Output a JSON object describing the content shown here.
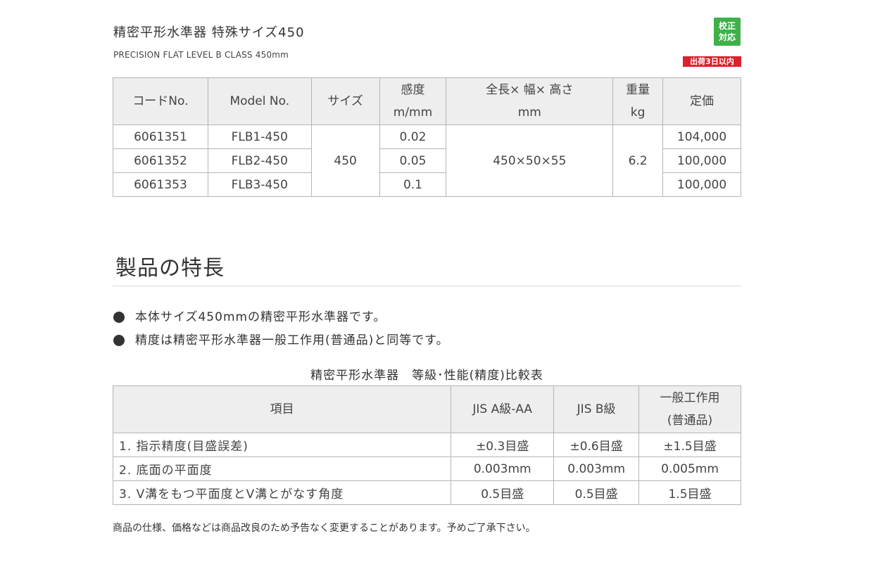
{
  "header": {
    "title": "精密平形水準器 特殊サイズ450",
    "subtitle": "PRECISION FLAT LEVEL B CLASS 450mm",
    "badge_calibration": "校正対応",
    "badge_shipping": "出荷3日以内",
    "colors": {
      "calibration_badge": "#3fb04a",
      "shipping_badge": "#d9232f"
    }
  },
  "spec_table": {
    "headers": {
      "code": "コードNo.",
      "model": "Model No.",
      "size": "サイズ",
      "sensitivity_line1": "感度",
      "sensitivity_line2": "m/mm",
      "dims_line1": "全長× 幅× 高さ",
      "dims_line2": "mm",
      "weight_line1": "重量",
      "weight_line2": "kg",
      "price": "定価"
    },
    "rows": [
      {
        "code": "6061351",
        "model": "FLB1-450",
        "sensitivity": "0.02",
        "price": "104,000"
      },
      {
        "code": "6061352",
        "model": "FLB2-450",
        "sensitivity": "0.05",
        "price": "100,000"
      },
      {
        "code": "6061353",
        "model": "FLB3-450",
        "sensitivity": "0.1",
        "price": "100,000"
      }
    ],
    "shared": {
      "size": "450",
      "dims": "450×50×55",
      "weight": "6.2"
    }
  },
  "features": {
    "heading": "製品の特長",
    "bullets": [
      "本体サイズ450mmの精密平形水準器です。",
      "精度は精密平形水準器一般工作用(普通品)と同等です。"
    ]
  },
  "comparison": {
    "caption": "精密平形水準器　等級･性能(精度)比較表",
    "headers": {
      "item": "項目",
      "jis_aa": "JIS A級-AA",
      "jis_b": "JIS B級",
      "general_line1": "一般工作用",
      "general_line2": "(普通品)"
    },
    "rows": [
      {
        "item": "1. 指示精度(目盛誤差)",
        "jis_aa": "±0.3目盛",
        "jis_b": "±0.6目盛",
        "general": "±1.5目盛"
      },
      {
        "item": "2. 底面の平面度",
        "jis_aa": "0.003mm",
        "jis_b": "0.003mm",
        "general": "0.005mm"
      },
      {
        "item": "3. V溝をもつ平面度とV溝とがなす角度",
        "jis_aa": "0.5目盛",
        "jis_b": "0.5目盛",
        "general": "1.5目盛"
      }
    ]
  },
  "footer": {
    "note": "商品の仕様、価格などは商品改良のため予告なく変更することがあります。予めご了承下さい。"
  }
}
